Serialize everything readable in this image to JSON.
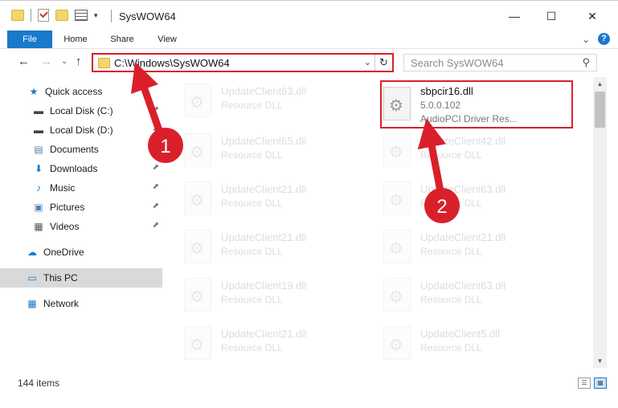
{
  "window": {
    "title": "SysWOW64",
    "controls": {
      "minimize": "—",
      "maximize": "☐",
      "close": "✕"
    }
  },
  "ribbon": {
    "tabs": [
      "File",
      "Home",
      "Share",
      "View"
    ],
    "expand_glyph": "⌄",
    "help": "?"
  },
  "nav": {
    "back": "←",
    "forward": "→",
    "recent": "⌄",
    "up": "↑",
    "address_path": "C:\\Windows\\SysWOW64",
    "address_dropdown": "⌄",
    "refresh": "↻",
    "search_placeholder": "Search SysWOW64",
    "search_icon": "⚲"
  },
  "sidebar": {
    "items": [
      {
        "label": "Quick access",
        "icon": "star-icon",
        "glyph": "★",
        "color": "#1979ca"
      },
      {
        "label": "Local Disk (C:)",
        "icon": "drive-icon",
        "glyph": "▬",
        "color": "#444444",
        "pinned": true
      },
      {
        "label": "Local Disk (D:)",
        "icon": "drive-icon",
        "glyph": "▬",
        "color": "#444444",
        "pinned": true
      },
      {
        "label": "Documents",
        "icon": "documents-icon",
        "glyph": "▤",
        "color": "#5a7fa8",
        "pinned": true
      },
      {
        "label": "Downloads",
        "icon": "download-icon",
        "glyph": "⬇",
        "color": "#1979ca",
        "pinned": true
      },
      {
        "label": "Music",
        "icon": "music-icon",
        "glyph": "♪",
        "color": "#1979ca",
        "pinned": true
      },
      {
        "label": "Pictures",
        "icon": "pictures-icon",
        "glyph": "▣",
        "color": "#4f7fb5",
        "pinned": true
      },
      {
        "label": "Videos",
        "icon": "videos-icon",
        "glyph": "▦",
        "color": "#555555",
        "pinned": true
      },
      {
        "label": "OneDrive",
        "icon": "cloud-icon",
        "glyph": "☁",
        "color": "#1979ca"
      },
      {
        "label": "This PC",
        "icon": "computer-icon",
        "glyph": "▭",
        "color": "#1979ca",
        "selected": true
      },
      {
        "label": "Network",
        "icon": "network-icon",
        "glyph": "▦",
        "color": "#1979ca"
      }
    ],
    "pin_glyph": "📌"
  },
  "files": {
    "left_column": [
      {
        "name": "UpdateClient63.dll",
        "type": "Resource DLL"
      },
      {
        "name": "UpdateClient65.dll",
        "type": "Resource DLL"
      },
      {
        "name": "UpdateClient21.dll",
        "type": "Resource DLL"
      },
      {
        "name": "UpdateClient21.dll",
        "type": "Resource DLL"
      },
      {
        "name": "UpdateClient19.dll",
        "type": "Resource DLL"
      },
      {
        "name": "UpdateClient21.dll",
        "type": "Resource DLL"
      }
    ],
    "right_column": [
      {
        "name": "UpdateClient42.dll",
        "type": "Resource DLL"
      },
      {
        "name": "UpdateClient63.dll",
        "type": "Resource DLL"
      },
      {
        "name": "UpdateClient21.dll",
        "type": "Resource DLL"
      },
      {
        "name": "UpdateClient63.dll",
        "type": "Resource DLL"
      },
      {
        "name": "UpdateClient5.dll",
        "type": "Resource DLL"
      }
    ],
    "highlighted": {
      "name": "sbpcir16.dll",
      "version": "5.0.0.102",
      "description": "AudioPCI Driver Res..."
    }
  },
  "annotations": {
    "step1": "1",
    "step2": "2",
    "color": "#d9202a"
  },
  "status": {
    "item_count": "144 items"
  },
  "scrollbar": {
    "up": "▲",
    "down": "▼"
  },
  "view_toggles": {
    "details": "☰",
    "tiles": "▦"
  }
}
